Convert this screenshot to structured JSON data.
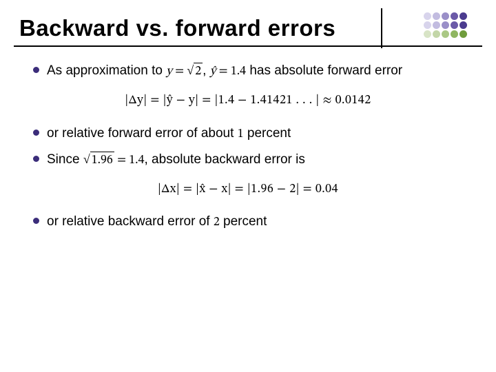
{
  "title": "Backward vs. forward errors",
  "para1_a": "As approximation to ",
  "para1_math1_lhs": "y",
  "para1_math1_eq": " = ",
  "para1_math1_arg": "2",
  "para1_b": ", ",
  "para1_math2_lhs": "ŷ",
  "para1_math2_eq": " = ",
  "para1_math2_rhs": "1.4",
  "para1_c": " has absolute forward error",
  "eq1": "|Δy| = |ŷ − y| = |1.4 − 1.41421 . . . | ≈ 0.0142",
  "para2": "or relative forward error of about ",
  "para2_num": "1",
  "para2_end": " percent",
  "para3_a": "Since ",
  "para3_sqrt_arg": "1.96",
  "para3_eq": " = ",
  "para3_val": "1.4",
  "para3_b": ", absolute backward error is",
  "eq2": "|Δx| = |x̂ − x| = |1.96 − 2| = 0.04",
  "para4": "or relative backward error of ",
  "para4_num": "2",
  "para4_end": " percent"
}
